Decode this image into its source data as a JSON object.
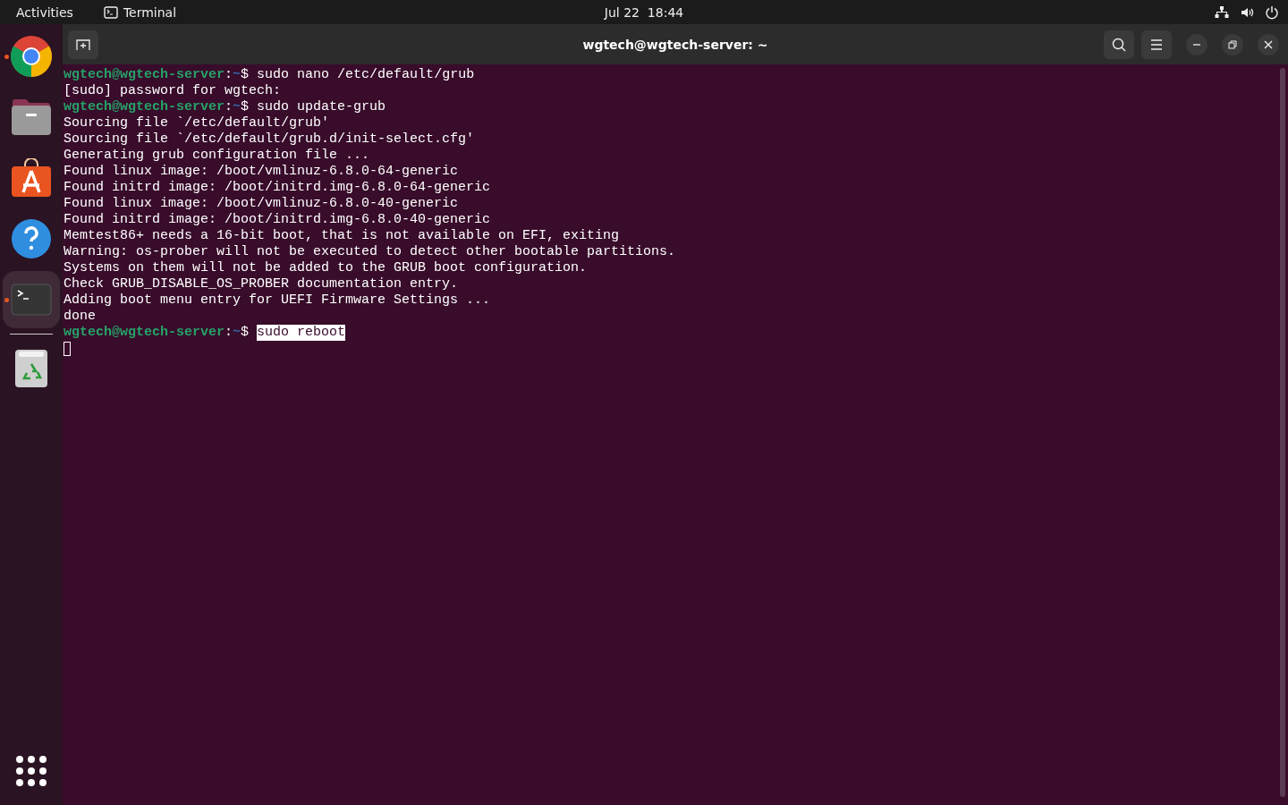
{
  "top_bar": {
    "activities": "Activities",
    "app_name": "Terminal",
    "clock": "Jul 22  18:44"
  },
  "dock": {
    "items": [
      {
        "kind": "browser",
        "running": true,
        "selected": false
      },
      {
        "kind": "files",
        "running": false,
        "selected": false
      },
      {
        "kind": "store",
        "running": false,
        "selected": false
      },
      {
        "kind": "help",
        "running": false,
        "selected": false
      },
      {
        "kind": "terminal",
        "running": true,
        "selected": true
      },
      {
        "kind": "trash",
        "running": false,
        "selected": false
      }
    ]
  },
  "window": {
    "title": "wgtech@wgtech-server: ~"
  },
  "terminal": {
    "lines": [
      {
        "kind": "prompt",
        "user_host": "wgtech@wgtech-server",
        "separator": ":",
        "path": "~",
        "symbol": "$",
        "command": "sudo nano /etc/default/grub",
        "selected": false
      },
      {
        "kind": "output",
        "text": "[sudo] password for wgtech:"
      },
      {
        "kind": "prompt",
        "user_host": "wgtech@wgtech-server",
        "separator": ":",
        "path": "~",
        "symbol": "$",
        "command": "sudo update-grub",
        "selected": false
      },
      {
        "kind": "output",
        "text": "Sourcing file `/etc/default/grub'"
      },
      {
        "kind": "output",
        "text": "Sourcing file `/etc/default/grub.d/init-select.cfg'"
      },
      {
        "kind": "output",
        "text": "Generating grub configuration file ..."
      },
      {
        "kind": "output",
        "text": "Found linux image: /boot/vmlinuz-6.8.0-64-generic"
      },
      {
        "kind": "output",
        "text": "Found initrd image: /boot/initrd.img-6.8.0-64-generic"
      },
      {
        "kind": "output",
        "text": "Found linux image: /boot/vmlinuz-6.8.0-40-generic"
      },
      {
        "kind": "output",
        "text": "Found initrd image: /boot/initrd.img-6.8.0-40-generic"
      },
      {
        "kind": "output",
        "text": "Memtest86+ needs a 16-bit boot, that is not available on EFI, exiting"
      },
      {
        "kind": "output",
        "text": "Warning: os-prober will not be executed to detect other bootable partitions."
      },
      {
        "kind": "output",
        "text": "Systems on them will not be added to the GRUB boot configuration."
      },
      {
        "kind": "output",
        "text": "Check GRUB_DISABLE_OS_PROBER documentation entry."
      },
      {
        "kind": "output",
        "text": "Adding boot menu entry for UEFI Firmware Settings ..."
      },
      {
        "kind": "output",
        "text": "done"
      },
      {
        "kind": "prompt",
        "user_host": "wgtech@wgtech-server",
        "separator": ":",
        "path": "~",
        "symbol": "$",
        "command": "sudo reboot",
        "selected": true
      },
      {
        "kind": "cursor"
      }
    ]
  }
}
